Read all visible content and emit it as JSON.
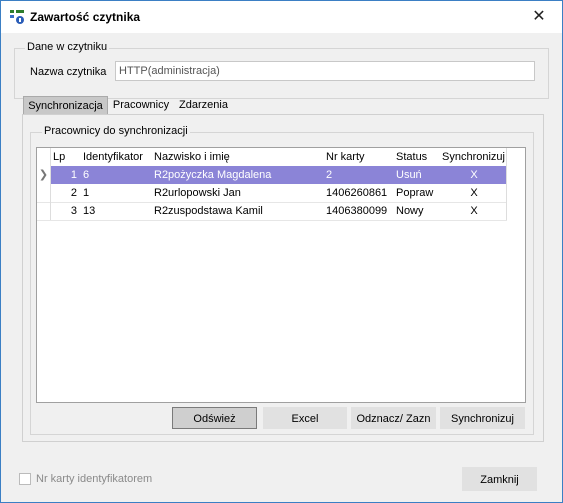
{
  "window": {
    "title": "Zawartość czytnika",
    "close_glyph": "✕"
  },
  "reader_group": {
    "legend": "Dane w czytniku",
    "name_label": "Nazwa czytnika",
    "name_value": "HTTP(administracja)"
  },
  "tabs": [
    {
      "label": "Synchronizacja",
      "active": true
    },
    {
      "label": "Pracownicy",
      "active": false
    },
    {
      "label": "Zdarzenia",
      "active": false
    }
  ],
  "sync_group": {
    "legend": "Pracownicy do synchronizacji",
    "columns": [
      "Lp",
      "Identyfikator",
      "Nazwisko i imię",
      "Nr karty",
      "Status",
      "Synchronizuj"
    ],
    "rows": [
      {
        "lp": "1",
        "id": "6",
        "name": "R2pożyczka Magdalena",
        "card": "2",
        "status": "Usuń",
        "sync": "X",
        "selected": true,
        "indicator": "❯"
      },
      {
        "lp": "2",
        "id": "1",
        "name": "R2urlopowski Jan",
        "card": "1406260861",
        "status": "Popraw",
        "sync": "X",
        "selected": false,
        "indicator": ""
      },
      {
        "lp": "3",
        "id": "13",
        "name": "R2zuspodstawa Kamil",
        "card": "1406380099",
        "status": "Nowy",
        "sync": "X",
        "selected": false,
        "indicator": ""
      }
    ],
    "buttons": {
      "refresh": "Odśwież",
      "excel": "Excel",
      "toggle": "Odznacz/ Zazn",
      "sync": "Synchronizuj"
    }
  },
  "footer": {
    "checkbox_label": "Nr karty identyfikatorem",
    "close_button": "Zamknij"
  }
}
